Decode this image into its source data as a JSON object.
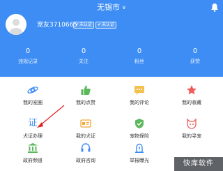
{
  "header": {
    "city": "无锡市",
    "username": "宠友3710665",
    "badges": [
      "未认证",
      "未认证"
    ]
  },
  "stats": [
    {
      "value": "0",
      "label": "违规记录"
    },
    {
      "value": "0",
      "label": "关注"
    },
    {
      "value": "0",
      "label": "粉丝"
    },
    {
      "value": "0",
      "label": "获赞"
    }
  ],
  "grid": {
    "row1": [
      "我的宠圈",
      "我的点赞",
      "我的评论",
      "我的收藏"
    ],
    "row2": [
      "犬证办理",
      "我的犬证",
      "宠物保险",
      "我的寻宠"
    ],
    "row3": [
      "政府频道",
      "政府咨询",
      "举报曝光"
    ]
  },
  "icons": {
    "zheng_glyph": "证"
  },
  "watermark": "快库软件",
  "colors": {
    "primary": "#3d8df4",
    "thumb_green": "#5cb85c",
    "comment_yellow": "#f2c14e",
    "star_red": "#f05b5b",
    "arrow_red": "#e02020"
  }
}
